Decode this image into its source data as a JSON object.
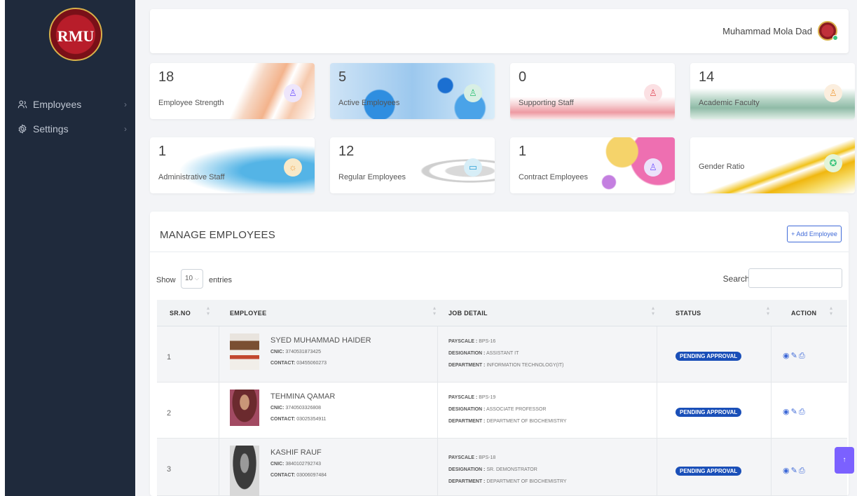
{
  "app": {
    "logo_text": "RMU"
  },
  "sidebar": {
    "items": [
      {
        "label": "Employees",
        "icon": "users-icon"
      },
      {
        "label": "Settings",
        "icon": "gear-icon"
      }
    ]
  },
  "header": {
    "user_name": "Muhammad Mola Dad"
  },
  "stats": [
    {
      "value": "18",
      "label": "Employee Strength"
    },
    {
      "value": "5",
      "label": "Active Employees"
    },
    {
      "value": "0",
      "label": "Supporting Staff"
    },
    {
      "value": "14",
      "label": "Academic Faculty"
    },
    {
      "value": "1",
      "label": "Administrative Staff"
    },
    {
      "value": "12",
      "label": "Regular Employees"
    },
    {
      "value": "1",
      "label": "Contract Employees"
    },
    {
      "value": "",
      "label": "Gender Ratio"
    }
  ],
  "manage": {
    "title": "MANAGE EMPLOYEES",
    "add_button": "+ Add Employee",
    "show_label": "Show",
    "page_size": "10",
    "entries_label": "entries",
    "search_label": "Search:",
    "search_value": ""
  },
  "table": {
    "headers": [
      "SR.NO",
      "EMPLOYEE",
      "JOB DETAIL",
      "STATUS",
      "ACTION"
    ],
    "rows": [
      {
        "sr": "1",
        "name": "SYED MUHAMMAD HAIDER",
        "cnic_label": "CNIC:",
        "cnic": "3740531873425",
        "contact_label": "CONTACT:",
        "contact": "03455060273",
        "payscale_label": "PAYSCALE :",
        "payscale": "BPS-16",
        "designation_label": "DESIGNATION :",
        "designation": "ASSISTANT IT",
        "department_label": "DEPARTMENT :",
        "department": "INFORMATION TECHNOLOGY(IT)",
        "status": "PENDING APPROVAL"
      },
      {
        "sr": "2",
        "name": "TEHMINA QAMAR",
        "cnic_label": "CNIC:",
        "cnic": "3740503326808",
        "contact_label": "CONTACT:",
        "contact": "03025354911",
        "payscale_label": "PAYSCALE :",
        "payscale": "BPS-19",
        "designation_label": "DESIGNATION :",
        "designation": "ASSOCIATE PROFESSOR",
        "department_label": "DEPARTMENT :",
        "department": "DEPARTMENT OF BIOCHEMISTRY",
        "status": "PENDING APPROVAL"
      },
      {
        "sr": "3",
        "name": "KASHIF RAUF",
        "cnic_label": "CNIC:",
        "cnic": "3840102792743",
        "contact_label": "CONTACT:",
        "contact": "03006097484",
        "payscale_label": "PAYSCALE :",
        "payscale": "BPS-18",
        "designation_label": "DESIGNATION :",
        "designation": "SR. DEMONSTRATOR",
        "department_label": "DEPARTMENT :",
        "department": "DEPARTMENT OF BIOCHEMISTRY",
        "status": "PENDING APPROVAL"
      }
    ]
  },
  "colors": {
    "sidebar": "#1f2a3c",
    "accent": "#3f6ad8",
    "badge": "#1a4fb8",
    "scroll_button": "#7b61ff"
  }
}
